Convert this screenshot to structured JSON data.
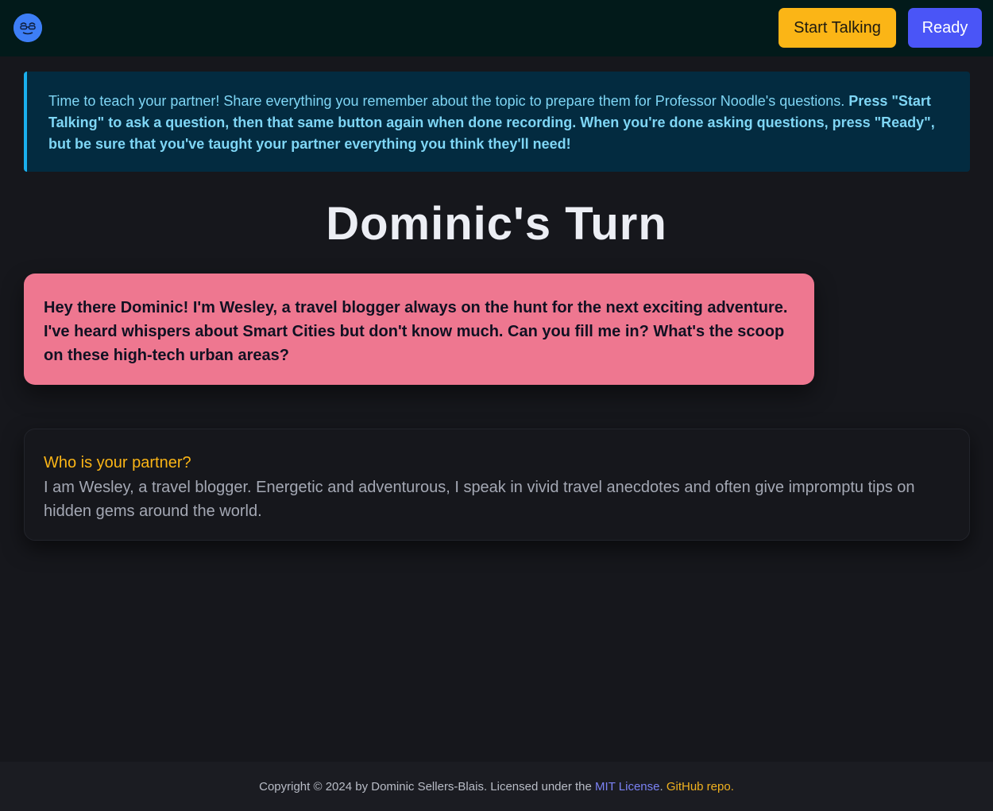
{
  "navbar": {
    "logo_icon": "noodle-face-logo-icon",
    "start_talking_label": "Start Talking",
    "ready_label": "Ready",
    "colors": {
      "start_talking": "#fbb516",
      "ready": "#4a55f7"
    }
  },
  "alert": {
    "text_plain": "Time to teach your partner! Share everything you remember about the topic to prepare them for Professor Noodle's questions. ",
    "text_bold": "Press \"Start Talking\" to ask a question, then that same button again when done recording. When you're done asking questions, press \"Ready\", but be sure that you've taught your partner everything you think they'll need!"
  },
  "main": {
    "title": "Dominic's Turn",
    "partner_message": "Hey there Dominic! I'm Wesley, a travel blogger always on the hunt for the next exciting adventure. I've heard whispers about Smart Cities but don't know much. Can you fill me in? What's the scoop on these high-tech urban areas?"
  },
  "partner_card": {
    "heading": "Who is your partner?",
    "description": "I am Wesley, a travel blogger. Energetic and adventurous, I speak in vivid travel anecdotes and often give impromptu tips on hidden gems around the world."
  },
  "footer": {
    "copyright": "Copyright © 2024 by Dominic Sellers-Blais. Licensed under the ",
    "license_link": "MIT License",
    "separator": ". ",
    "repo_link": "GitHub repo."
  }
}
